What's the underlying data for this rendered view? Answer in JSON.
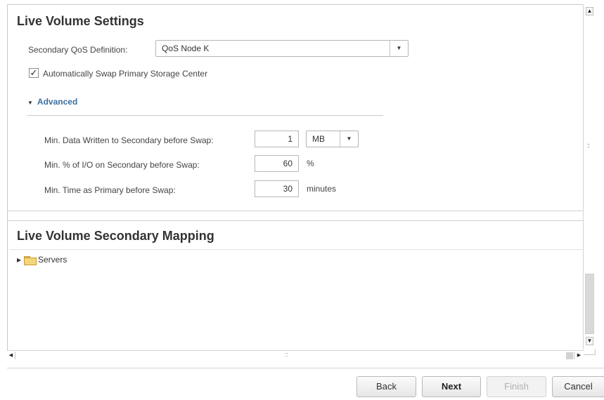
{
  "live_volume_settings": {
    "title": "Live Volume Settings",
    "qos_label": "Secondary QoS Definition:",
    "qos_value": "QoS Node K",
    "auto_swap_label": "Automatically Swap Primary Storage Center",
    "auto_swap_checked": true,
    "advanced_label": "Advanced",
    "advanced": {
      "min_data_label": "Min. Data Written to Secondary before Swap:",
      "min_data_value": "1",
      "min_data_unit": "MB",
      "min_io_label": "Min. % of I/O on Secondary before Swap:",
      "min_io_value": "60",
      "min_io_unit": "%",
      "min_time_label": "Min. Time as Primary before Swap:",
      "min_time_value": "30",
      "min_time_unit": "minutes"
    }
  },
  "secondary_mapping": {
    "title": "Live Volume Secondary Mapping",
    "tree_items": [
      {
        "label": "Servers",
        "icon": "folder-icon"
      }
    ]
  },
  "footer": {
    "back_label": "Back",
    "next_label": "Next",
    "finish_label": "Finish",
    "cancel_label": "Cancel"
  },
  "icons": {
    "check": "✓",
    "dropdown": "▼",
    "caret_expanded": "▼",
    "caret_collapsed": "▶"
  }
}
